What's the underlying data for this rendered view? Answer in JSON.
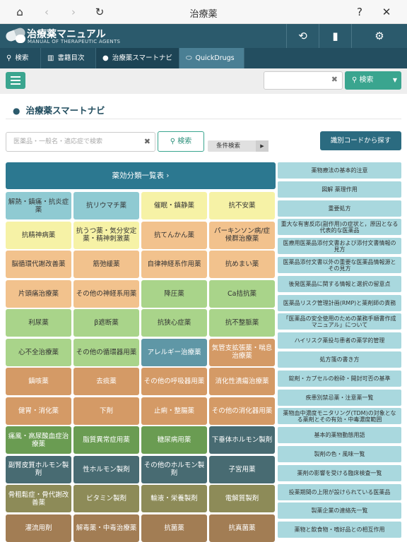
{
  "topbar": {
    "title": "治療薬"
  },
  "header": {
    "title": "治療薬マニュアル",
    "subtitle": "MANUAL OF THERAPEUTIC AGENTS"
  },
  "tabs": [
    {
      "label": "検索"
    },
    {
      "label": "書籍目次"
    },
    {
      "label": "治療薬スマートナビ"
    },
    {
      "label": "QuickDrugs"
    }
  ],
  "toolbar": {
    "search_value": "",
    "search_label": "検索"
  },
  "section_title": "治療薬スマートナビ",
  "search": {
    "placeholder": "医薬品・一般名・適応症で検索",
    "button": "検索",
    "condition": "条件検索",
    "id_code": "識別コードから探す"
  },
  "category_header": "薬効分類一覧表 ›",
  "categories": [
    {
      "label": "解熱・鎮痛・抗炎症薬",
      "bg": "#8fcad2",
      "fg": "#333333"
    },
    {
      "label": "抗リウマチ薬",
      "bg": "#8fcad2",
      "fg": "#333333"
    },
    {
      "label": "催眠・鎮静薬",
      "bg": "#f6f2a6",
      "fg": "#333333"
    },
    {
      "label": "抗不安薬",
      "bg": "#f6f2a6",
      "fg": "#333333"
    },
    {
      "label": "抗精神病薬",
      "bg": "#f6f2a6",
      "fg": "#333333"
    },
    {
      "label": "抗うつ薬・気分安定薬・精神刺激薬",
      "bg": "#f6f2a6",
      "fg": "#333333"
    },
    {
      "label": "抗てんかん薬",
      "bg": "#f2c28d",
      "fg": "#333333"
    },
    {
      "label": "パーキンソン病/症候群治療薬",
      "bg": "#f2c28d",
      "fg": "#333333"
    },
    {
      "label": "脳循環代謝改善薬",
      "bg": "#f2c28d",
      "fg": "#333333"
    },
    {
      "label": "筋弛緩薬",
      "bg": "#f2c28d",
      "fg": "#333333"
    },
    {
      "label": "自律神経系作用薬",
      "bg": "#f2c28d",
      "fg": "#333333"
    },
    {
      "label": "抗めまい薬",
      "bg": "#f2c28d",
      "fg": "#333333"
    },
    {
      "label": "片頭痛治療薬",
      "bg": "#f2c28d",
      "fg": "#333333"
    },
    {
      "label": "その他の神経系用薬",
      "bg": "#f2c28d",
      "fg": "#333333"
    },
    {
      "label": "降圧薬",
      "bg": "#a9d48a",
      "fg": "#333333"
    },
    {
      "label": "Ca拮抗薬",
      "bg": "#a9d48a",
      "fg": "#333333"
    },
    {
      "label": "利尿薬",
      "bg": "#a9d48a",
      "fg": "#333333"
    },
    {
      "label": "β遮断薬",
      "bg": "#a9d48a",
      "fg": "#333333"
    },
    {
      "label": "抗狭心症薬",
      "bg": "#a9d48a",
      "fg": "#333333"
    },
    {
      "label": "抗不整脈薬",
      "bg": "#a9d48a",
      "fg": "#333333"
    },
    {
      "label": "心不全治療薬",
      "bg": "#a9d48a",
      "fg": "#333333"
    },
    {
      "label": "その他の循環器用薬",
      "bg": "#a9d48a",
      "fg": "#333333"
    },
    {
      "label": "アレルギー治療薬",
      "bg": "#5f97a6",
      "fg": "#ffffff"
    },
    {
      "label": "気管支拡張薬・喘息治療薬",
      "bg": "#d49a66",
      "fg": "#ffffff"
    },
    {
      "label": "鎮咳薬",
      "bg": "#d49a66",
      "fg": "#ffffff"
    },
    {
      "label": "去痰薬",
      "bg": "#d49a66",
      "fg": "#ffffff"
    },
    {
      "label": "その他の呼吸器用薬",
      "bg": "#d49a66",
      "fg": "#ffffff"
    },
    {
      "label": "消化性潰瘍治療薬",
      "bg": "#d49a66",
      "fg": "#ffffff"
    },
    {
      "label": "健胃・消化薬",
      "bg": "#d49a66",
      "fg": "#ffffff"
    },
    {
      "label": "下剤",
      "bg": "#d49a66",
      "fg": "#ffffff"
    },
    {
      "label": "止痢・整腸薬",
      "bg": "#d49a66",
      "fg": "#ffffff"
    },
    {
      "label": "その他の消化器用薬",
      "bg": "#d49a66",
      "fg": "#ffffff"
    },
    {
      "label": "痛風・高尿酸血症治療薬",
      "bg": "#6a9c52",
      "fg": "#ffffff"
    },
    {
      "label": "脂質異常症用薬",
      "bg": "#6a9c52",
      "fg": "#ffffff"
    },
    {
      "label": "糖尿病用薬",
      "bg": "#6a9c52",
      "fg": "#ffffff"
    },
    {
      "label": "下垂体ホルモン製剤",
      "bg": "#486b72",
      "fg": "#ffffff"
    },
    {
      "label": "副腎皮質ホルモン製剤",
      "bg": "#486b72",
      "fg": "#ffffff"
    },
    {
      "label": "性ホルモン製剤",
      "bg": "#486b72",
      "fg": "#ffffff"
    },
    {
      "label": "その他のホルモン製剤",
      "bg": "#486b72",
      "fg": "#ffffff"
    },
    {
      "label": "子宮用薬",
      "bg": "#486b72",
      "fg": "#ffffff"
    },
    {
      "label": "骨粗鬆症・骨代謝改善薬",
      "bg": "#8d8b58",
      "fg": "#ffffff"
    },
    {
      "label": "ビタミン製剤",
      "bg": "#8d8b58",
      "fg": "#ffffff"
    },
    {
      "label": "輸液・栄養製剤",
      "bg": "#8d8b58",
      "fg": "#ffffff"
    },
    {
      "label": "電解質製剤",
      "bg": "#8d8b58",
      "fg": "#ffffff"
    },
    {
      "label": "灌流用剤",
      "bg": "#a27d54",
      "fg": "#ffffff"
    },
    {
      "label": "解毒薬・中毒治療薬",
      "bg": "#a27d54",
      "fg": "#ffffff"
    },
    {
      "label": "抗菌薬",
      "bg": "#a27d54",
      "fg": "#ffffff"
    },
    {
      "label": "抗真菌薬",
      "bg": "#a27d54",
      "fg": "#ffffff"
    }
  ],
  "right_buttons": [
    "薬物療法の基本的注意",
    "図解 薬理作用",
    "重要処方",
    "重大な有害反応(副作用)の症状と，原因となる代表的な医薬品",
    "医療用医薬品添付文書および添付文書情報の見方",
    "医薬品添付文書以外の重要な医薬品情報源とその見方",
    "後発医薬品に関する情報と選択の留意点",
    "医薬品リスク管理計画(RMP)と薬剤師の責務",
    "「医薬品の安全使用のための業務手順書作成マニュアル」について",
    "ハイリスク薬投与患者の薬学的管理",
    "処方箋の書き方",
    "錠剤・カプセルの粉砕・開封可否の基準",
    "疾患別禁忌薬・注意薬一覧",
    "薬物血中濃度モニタリング(TDM)の対象となる薬剤とその有効・中毒濃度範囲",
    "基本的薬物動態用語",
    "製剤の色・風味一覧",
    "薬剤の影響を受ける臨床検査一覧",
    "投薬期間の上限が設けられている医薬品",
    "製薬企業の連絡先一覧",
    "薬物と飲食物・嗜好品との相互作用"
  ]
}
